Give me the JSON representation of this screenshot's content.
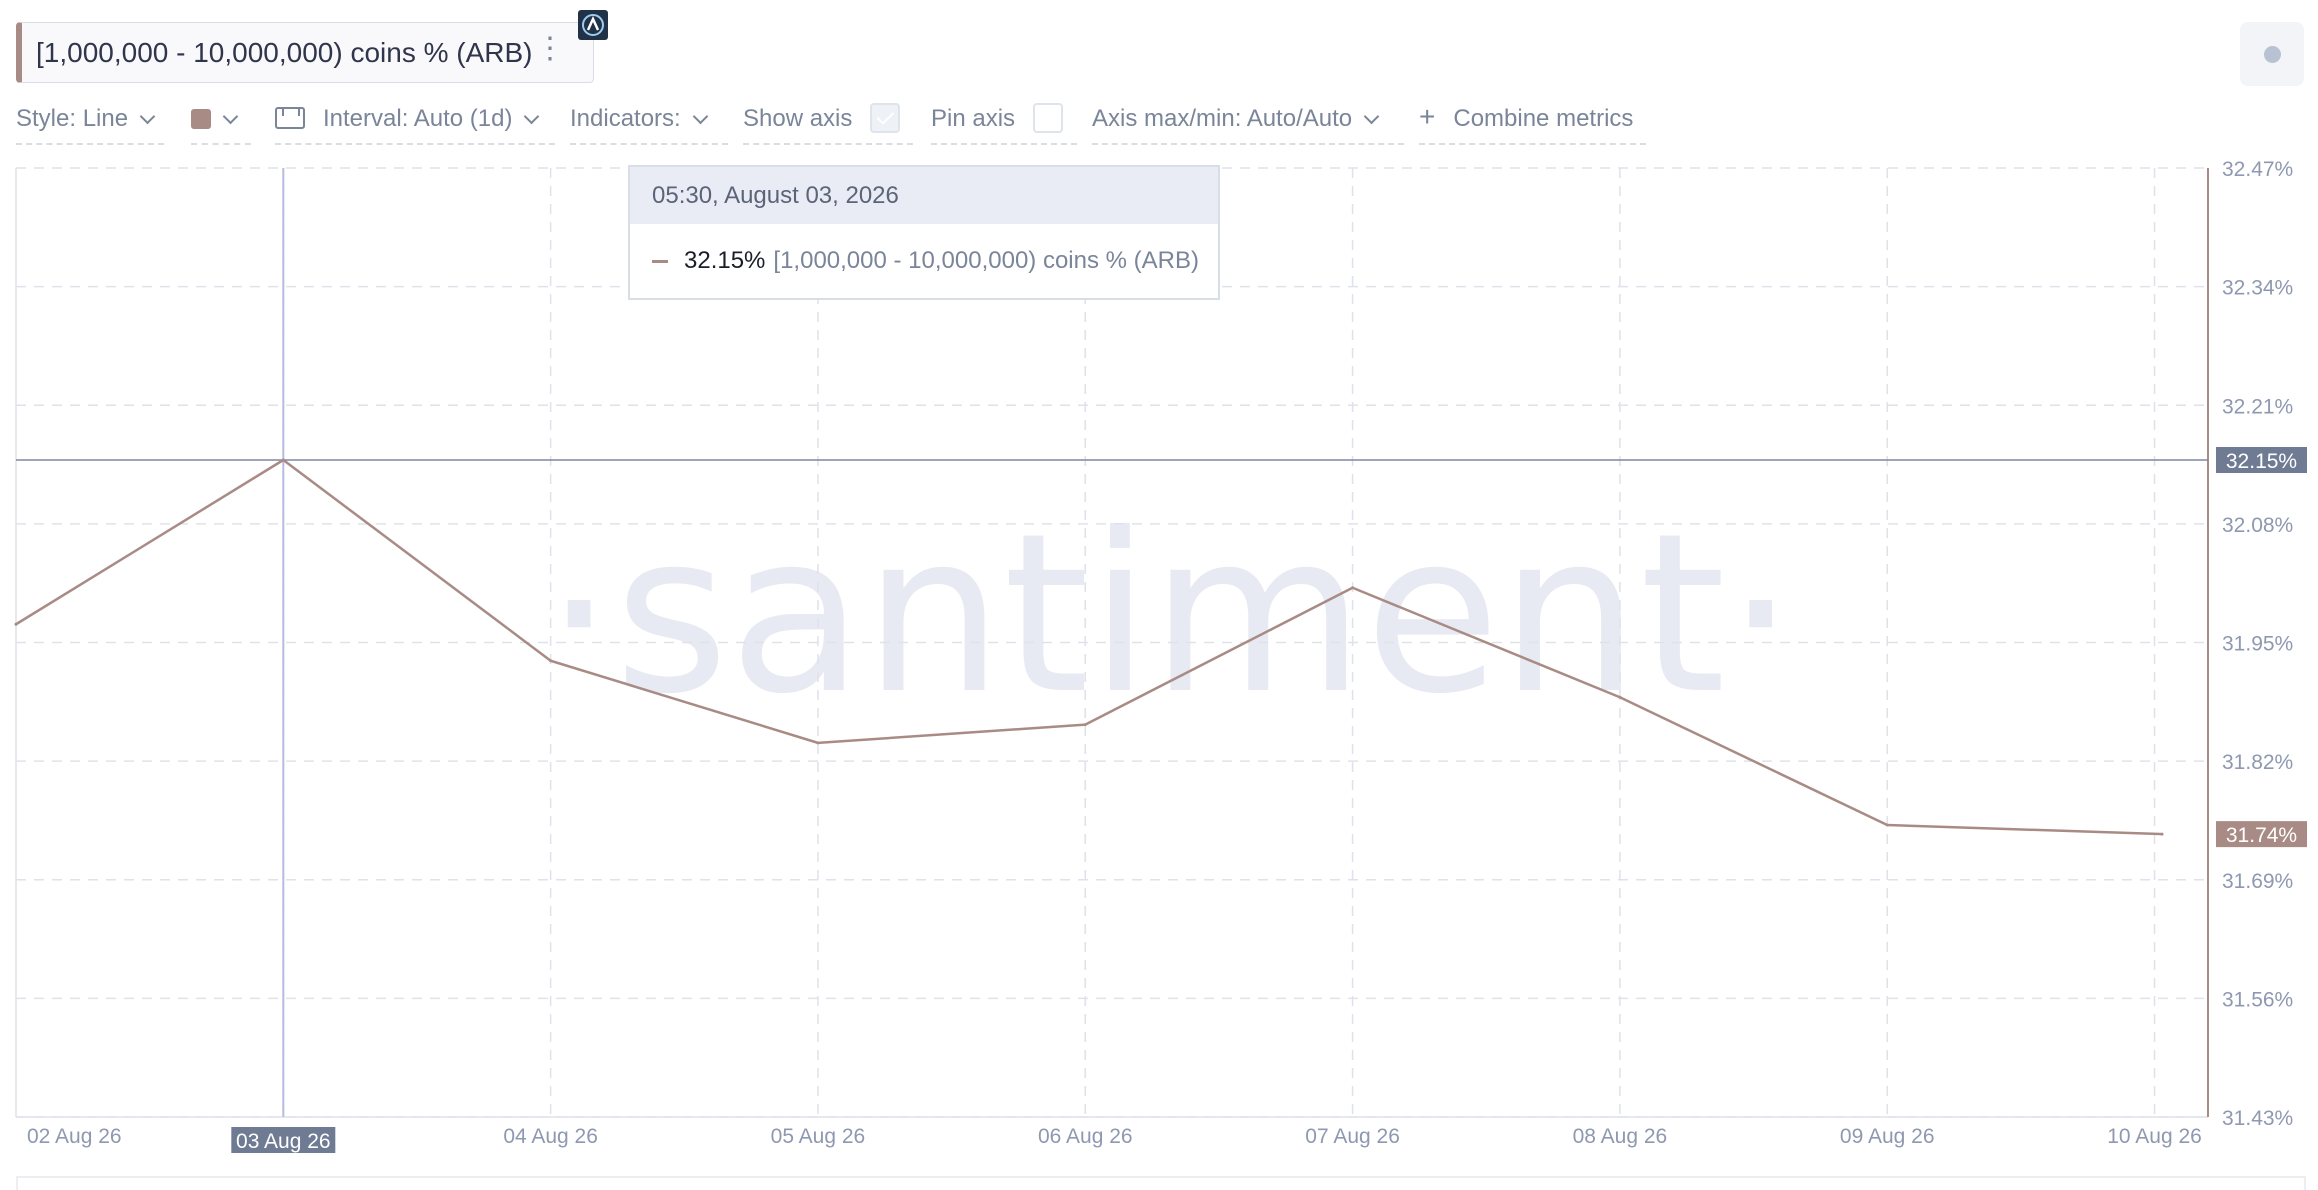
{
  "header": {
    "metric_label": "[1,000,000 - 10,000,000) coins % (ARB)",
    "menu_icon": "more-vertical-icon",
    "asset_icon": "arbitrum-logo-icon",
    "record_icon": "record-dot-icon"
  },
  "toolbar": {
    "style_label": "Style: Line",
    "interval_label": "Interval: Auto (1d)",
    "indicators_label": "Indicators:",
    "show_axis_label": "Show axis",
    "show_axis_checked": true,
    "pin_axis_label": "Pin axis",
    "pin_axis_checked": false,
    "axis_maxmin_label": "Axis max/min: Auto/Auto",
    "combine_label": "Combine metrics",
    "color_swatch": "#a98b85"
  },
  "tooltip": {
    "datetime": "05:30, August 03, 2026",
    "value": "32.15%",
    "series_name": "[1,000,000 - 10,000,000) coins % (ARB)"
  },
  "chart_data": {
    "type": "line",
    "x": [
      "02 Aug 26",
      "03 Aug 26",
      "04 Aug 26",
      "05 Aug 26",
      "06 Aug 26",
      "07 Aug 26",
      "08 Aug 26",
      "09 Aug 26",
      "10 Aug 26"
    ],
    "series": [
      {
        "name": "[1,000,000 - 10,000,000) coins % (ARB)",
        "color": "#a98b85",
        "values": [
          31.97,
          32.15,
          31.93,
          31.84,
          31.86,
          32.01,
          31.89,
          31.75,
          31.74
        ]
      }
    ],
    "y_ticks": [
      "32.47%",
      "32.34%",
      "32.21%",
      "32.08%",
      "31.95%",
      "31.82%",
      "31.69%",
      "31.56%",
      "31.43%"
    ],
    "ylim": [
      31.43,
      32.47
    ],
    "grid": true,
    "watermark": "·santiment·",
    "crosshair": {
      "x_label": "03 Aug 26",
      "y_label": "32.15%",
      "y_value": 32.15
    },
    "last_value_label": "31.74%",
    "last_value": 31.74,
    "colors": {
      "line": "#a98b85",
      "crosshair": "#7e87a0",
      "crosshair_v": "#b6bbdd",
      "grid": "#dfe2ea",
      "axis_text": "#8e98b0",
      "watermark": "#e8eaf3"
    }
  }
}
